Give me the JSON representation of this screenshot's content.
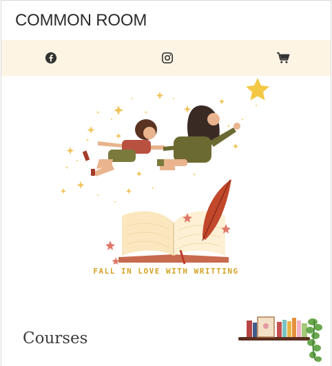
{
  "header": {
    "site_title": "COMMON ROOM"
  },
  "social_bar": {
    "icons": [
      "facebook-icon",
      "instagram-icon",
      "cart-icon"
    ],
    "background": "#fdf4e4"
  },
  "hero": {
    "caption": "FALL IN LOVE WITH WRITTING"
  },
  "section": {
    "title": "Courses"
  },
  "colors": {
    "caption_color": "#d4a224",
    "title_color": "#2b2b2b"
  }
}
